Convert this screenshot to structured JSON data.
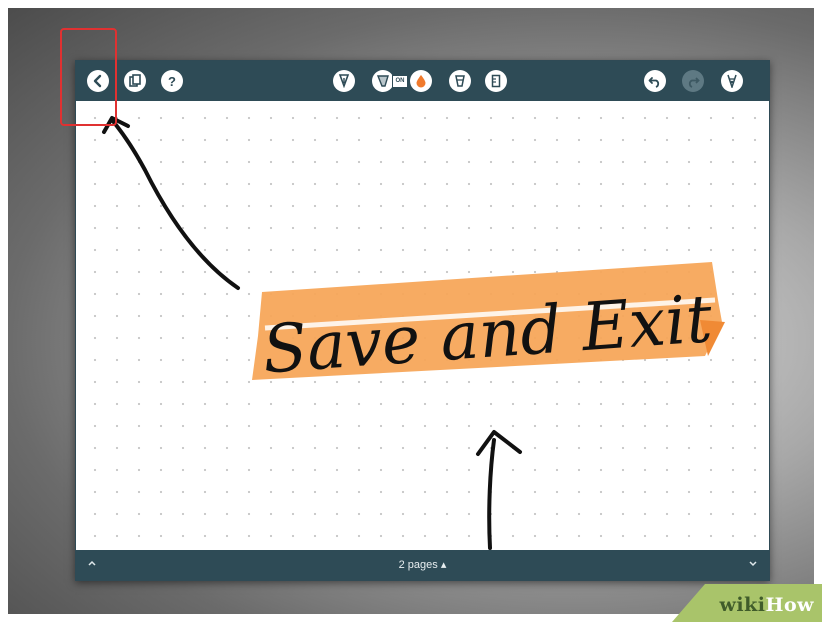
{
  "toolbar": {
    "left_buttons": [
      {
        "name": "back-button",
        "icon": "chevron-left-icon"
      },
      {
        "name": "pages-button",
        "icon": "pages-icon"
      },
      {
        "name": "help-button",
        "label": "?"
      }
    ],
    "center_tools": [
      {
        "name": "pen-tool",
        "icon": "pen-tip-icon"
      },
      {
        "name": "marker-tool",
        "icon": "marker-icon",
        "badge": "ON"
      },
      {
        "name": "ink-drop-tool",
        "icon": "drop-icon",
        "color": "#f07a2c"
      },
      {
        "name": "eraser-tool",
        "icon": "eraser-icon"
      },
      {
        "name": "ruler-tool",
        "icon": "ruler-icon"
      }
    ],
    "right_buttons": [
      {
        "name": "undo-button",
        "icon": "undo-icon"
      },
      {
        "name": "redo-button",
        "icon": "redo-icon",
        "disabled": true
      },
      {
        "name": "tool-settings-button",
        "icon": "nib-icon"
      }
    ]
  },
  "canvas": {
    "handwritten_text": "Save and Exit",
    "highlight_color": "#f7a65a"
  },
  "bottombar": {
    "pages_label": "2 pages ▴"
  },
  "watermark": {
    "wiki": "wiki",
    "how": "How"
  },
  "colors": {
    "toolbar": "#2e4b56",
    "callout": "#e03131",
    "ink": "#111111"
  }
}
